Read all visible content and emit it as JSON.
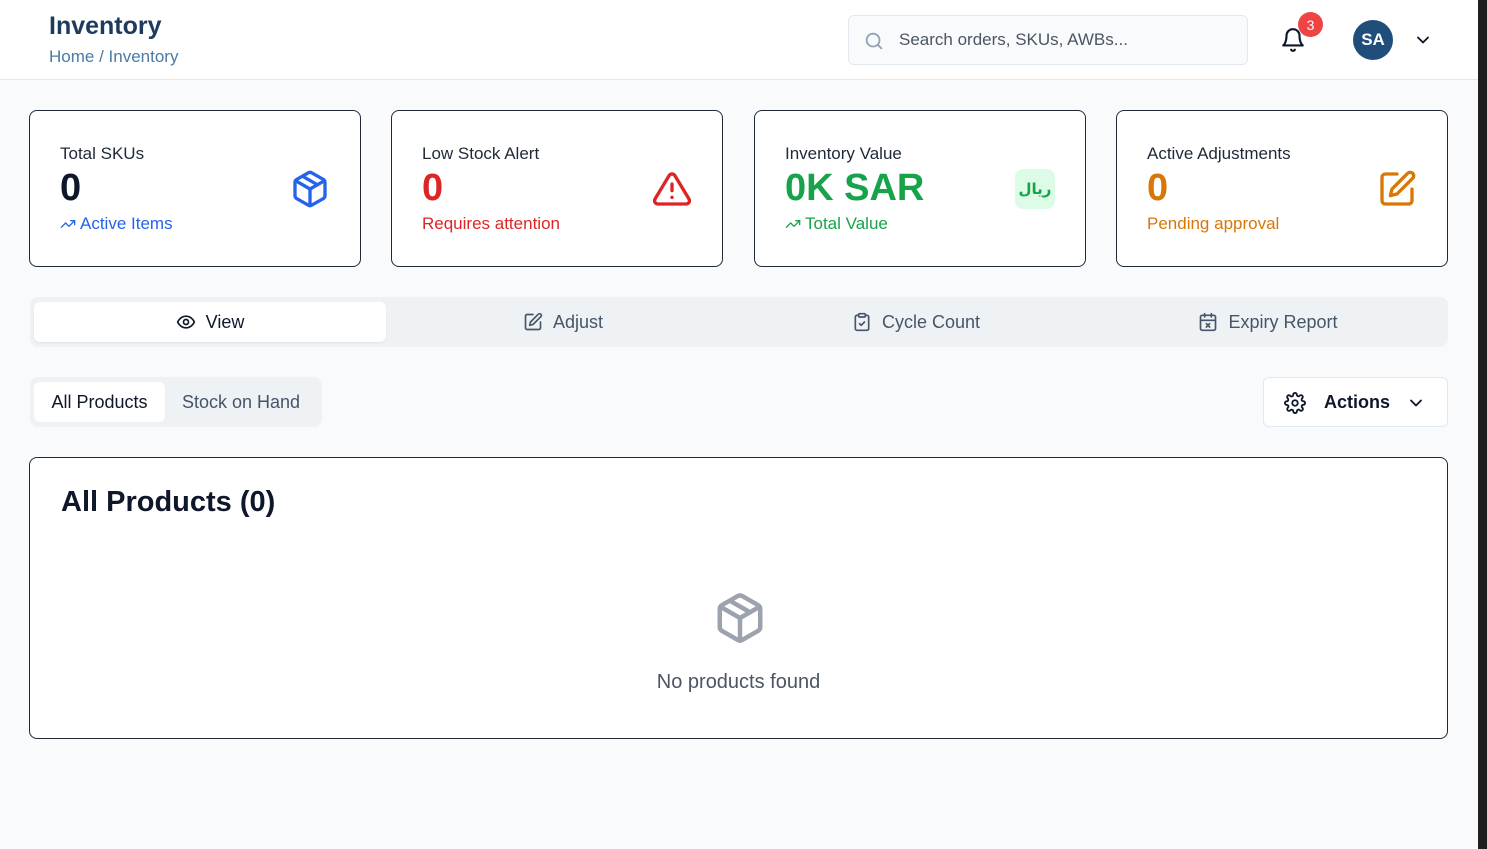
{
  "header": {
    "title": "Inventory",
    "breadcrumb": "Home / Inventory",
    "search_placeholder": "Search orders, SKUs, AWBs...",
    "notification_count": "3",
    "avatar_initials": "SA"
  },
  "stats": [
    {
      "label": "Total SKUs",
      "value": "0",
      "sub": "Active Items",
      "icon": "package-icon",
      "color": "#2563eb"
    },
    {
      "label": "Low Stock Alert",
      "value": "0",
      "sub": "Requires attention",
      "icon": "alert-triangle-icon",
      "color": "#dc2626"
    },
    {
      "label": "Inventory Value",
      "value": "0K SAR",
      "sub": "Total Value",
      "icon": "riyal-icon",
      "icon_text": "ريال",
      "color": "#16a34a"
    },
    {
      "label": "Active Adjustments",
      "value": "0",
      "sub": "Pending approval",
      "icon": "edit-icon",
      "color": "#d97706"
    }
  ],
  "tabs": [
    {
      "label": "View",
      "icon": "eye-icon",
      "active": true
    },
    {
      "label": "Adjust",
      "icon": "edit-icon",
      "active": false
    },
    {
      "label": "Cycle Count",
      "icon": "clipboard-check-icon",
      "active": false
    },
    {
      "label": "Expiry Report",
      "icon": "calendar-x-icon",
      "active": false
    }
  ],
  "subtabs": [
    {
      "label": "All Products",
      "active": true
    },
    {
      "label": "Stock on Hand",
      "active": false
    }
  ],
  "actions": {
    "label": "Actions"
  },
  "products": {
    "title": "All Products (0)",
    "empty_text": "No products found"
  }
}
